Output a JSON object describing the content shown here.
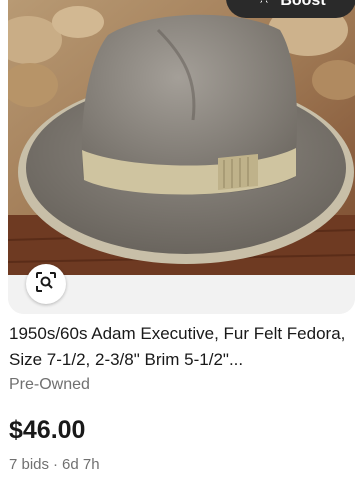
{
  "listing": {
    "boost_label": "Boost",
    "title": "1950s/60s Adam Executive, Fur Felt Fedora, Size 7-1/2, 2-3/8\" Brim 5-1/2\"...",
    "condition": "Pre-Owned",
    "price": "$46.00",
    "bids": "7 bids",
    "separator": "·",
    "time_left": "6d 7h",
    "image_icon": "visual-search-icon",
    "boost_icon": "boost-rocket-icon"
  },
  "colors": {
    "text_primary": "#191919",
    "text_secondary": "#707070",
    "boost_pill": "#2a2a2a",
    "image_footer_bg": "#f2f2f2"
  }
}
